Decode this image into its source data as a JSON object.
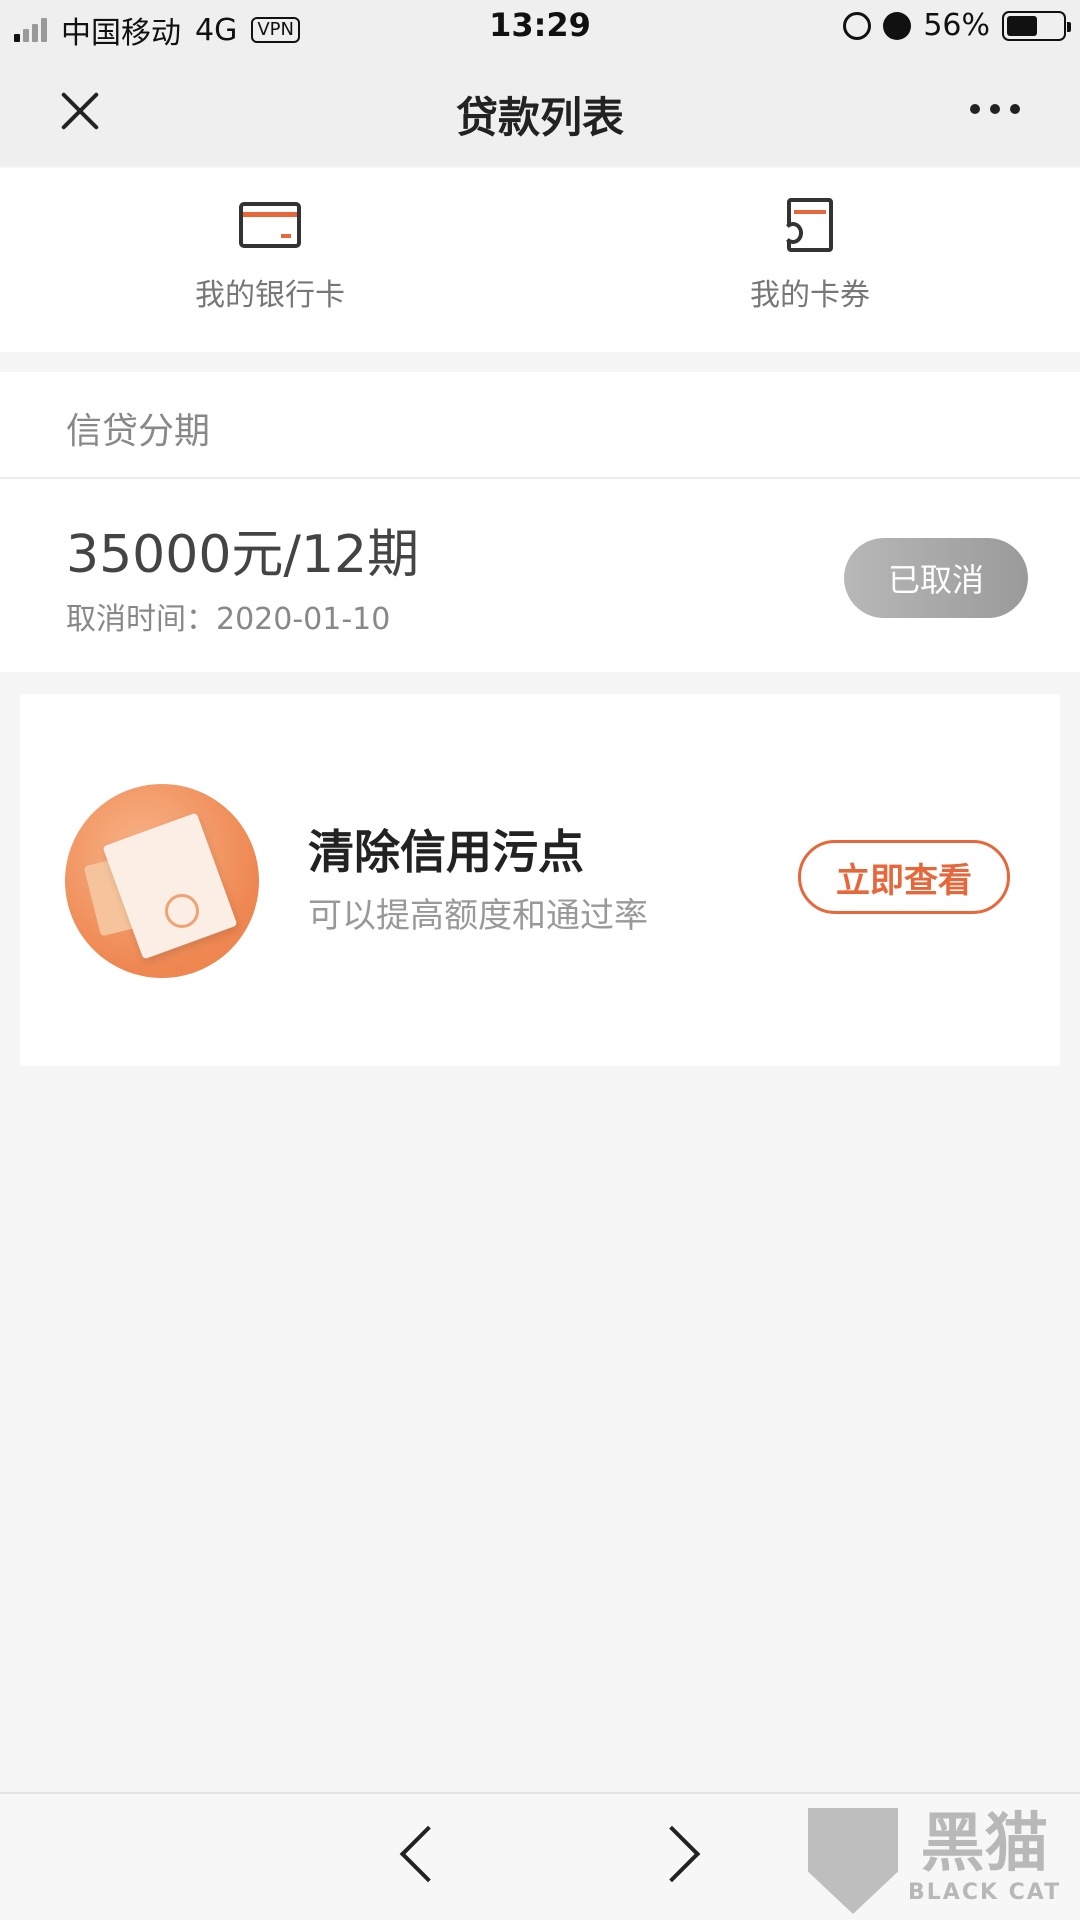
{
  "status_bar": {
    "carrier": "中国移动",
    "network": "4G",
    "vpn": "VPN",
    "time": "13:29",
    "battery": "56%"
  },
  "nav": {
    "title": "贷款列表"
  },
  "quick_entries": {
    "bank_card": "我的银行卡",
    "coupons": "我的卡券"
  },
  "loans": {
    "section_title": "信贷分期",
    "items": [
      {
        "amount": "35000元/12期",
        "cancel_time": "取消时间：2020-01-10",
        "status": "已取消"
      }
    ]
  },
  "promo": {
    "title": "清除信用污点",
    "subtitle": "可以提高额度和通过率",
    "button": "立即查看"
  },
  "watermark": {
    "main": "黑猫",
    "sub": "BLACK CAT"
  },
  "colors": {
    "accent": "#e8673a",
    "page_bg": "#f5f5f5",
    "status_pill": "#a8a8a8"
  },
  "battery_level": 0.56
}
